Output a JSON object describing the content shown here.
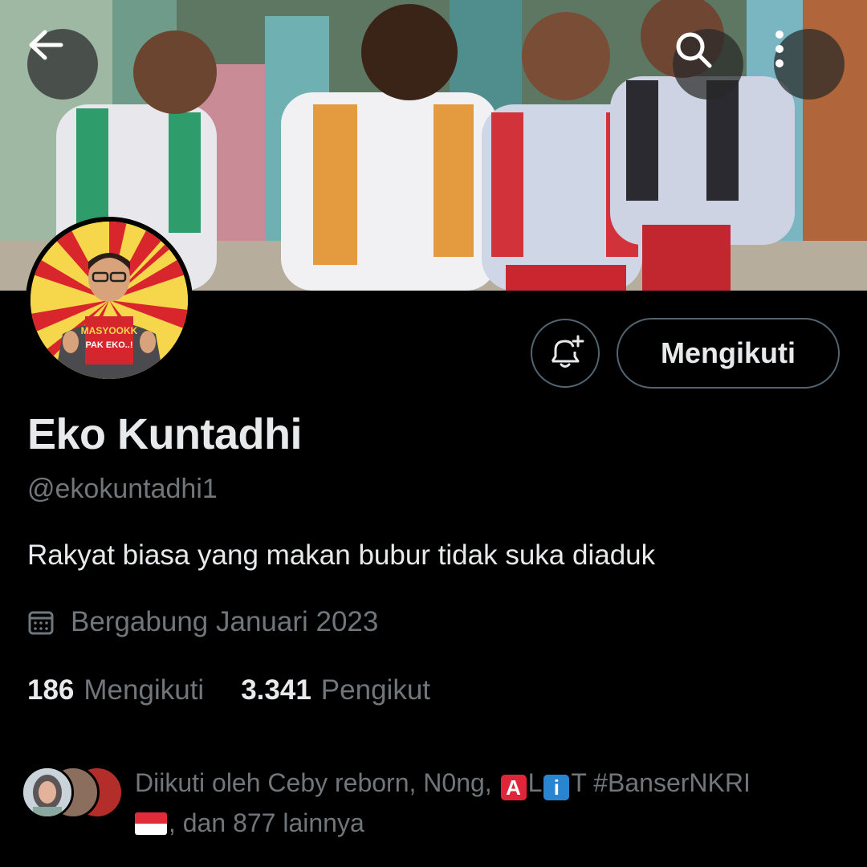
{
  "header": {
    "banner_alt": "banner-photo",
    "back_icon": "arrow-left-icon",
    "search_icon": "search-icon",
    "more_icon": "more-vertical-icon"
  },
  "profile": {
    "avatar_text_top": "MASYOOKK",
    "avatar_text_bottom": "PAK EKO..!",
    "name": "Eko Kuntadhi",
    "handle": "@ekokuntadhi1",
    "bio": "Rakyat biasa yang makan bubur tidak suka diaduk",
    "joined": "Bergabung Januari 2023",
    "following_count": "186",
    "following_label": "Mengikuti",
    "followers_count": "3.341",
    "followers_label": "Pengikut"
  },
  "actions": {
    "follow_label": "Mengikuti",
    "bell_icon": "bell-plus-icon"
  },
  "followed_by": {
    "prefix": "Diikuti oleh Ceby reborn, N0ng, ",
    "emoji_a": "A",
    "letter_l": "L",
    "emoji_i": "i",
    "suffix_t": "T #BanserNKRI",
    "trailer": ", dan 877 lainnya"
  },
  "colors": {
    "background": "#000000",
    "text_primary": "#e7e9ea",
    "text_secondary": "#71767b",
    "border": "#536471"
  }
}
